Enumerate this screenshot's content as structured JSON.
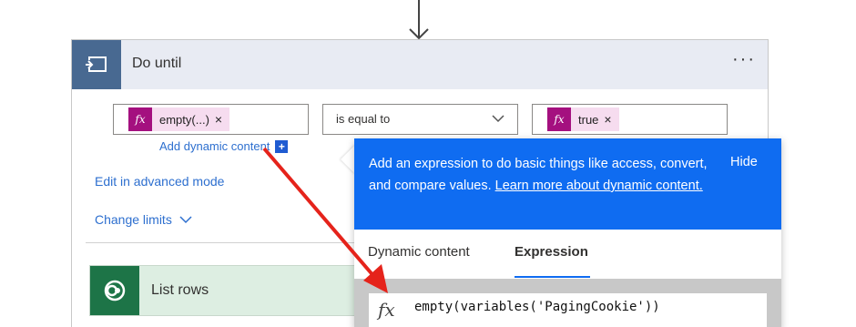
{
  "card": {
    "title": "Do until",
    "more_label": "···",
    "header_icon": "loop-icon",
    "header_color": "#486991"
  },
  "condition": {
    "left_token": "empty(...)",
    "left_remove": "×",
    "operator": "is equal to",
    "right_token": "true",
    "right_remove": "×",
    "fx_label": "fx",
    "token_color": "#a4107f"
  },
  "add_dynamic": {
    "label": "Add dynamic content",
    "plus": "+"
  },
  "links": {
    "advanced_mode": "Edit in advanced mode",
    "change_limits": "Change limits"
  },
  "list_rows": {
    "title": "List rows",
    "icon": "dataverse-icon",
    "color": "#1d7447"
  },
  "popup": {
    "description": "Add an expression to do basic things like access, convert, and compare values.",
    "learn_more": "Learn more about dynamic content.",
    "hide_label": "Hide",
    "tabs": [
      "Dynamic content",
      "Expression"
    ],
    "active_tab": "Expression",
    "expression_fx": "fx",
    "expression_value": "empty(variables('PagingCookie'))",
    "banner_color": "#0f6cf1"
  }
}
